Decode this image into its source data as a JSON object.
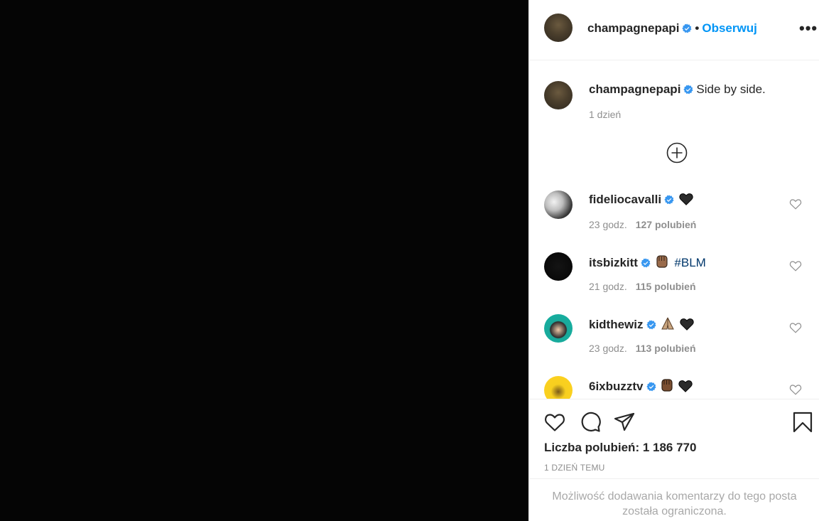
{
  "header": {
    "username": "champagnepapi",
    "separator": "•",
    "follow_label": "Obserwuj",
    "more_label": "•••"
  },
  "caption": {
    "username": "champagnepapi",
    "text": "Side by side.",
    "time": "1 dzień"
  },
  "comments": [
    {
      "username": "fideliocavalli",
      "text": "",
      "emojis": [
        "black-heart"
      ],
      "time": "23 godz.",
      "likes": "127 polubień"
    },
    {
      "username": "itsbizkitt",
      "text": "#BLM",
      "emojis": [
        "raised-fist"
      ],
      "time": "21 godz.",
      "likes": "115 polubień"
    },
    {
      "username": "kidthewiz",
      "text": "",
      "emojis": [
        "folded-hands",
        "black-heart"
      ],
      "time": "23 godz.",
      "likes": "113 polubień"
    },
    {
      "username": "6ixbuzztv",
      "text": "",
      "emojis": [
        "raised-fist",
        "black-heart"
      ],
      "time": "",
      "likes": ""
    }
  ],
  "actions": {
    "likes_total": "Liczba polubień: 1 186 770",
    "post_time": "1 DZIEŃ TEMU"
  },
  "restricted": {
    "line1": "Możliwość dodawania komentarzy do tego posta",
    "line2": "została ograniczona."
  },
  "colors": {
    "accent": "#0095f6",
    "verified": "#3897f0",
    "media_bg": "#050505",
    "secondary_text": "#8e8e8e"
  }
}
